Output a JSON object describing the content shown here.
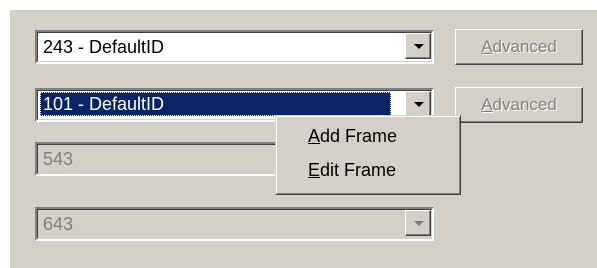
{
  "rows": [
    {
      "value": "243 - DefaultID",
      "state": "normal",
      "advanced_label": "Advanced",
      "advanced_accel": "A",
      "advanced_rest": "dvanced"
    },
    {
      "value": "101 - DefaultID",
      "state": "focused-selected",
      "advanced_label": "Advanced",
      "advanced_accel": "A",
      "advanced_rest": "dvanced"
    },
    {
      "value": "543",
      "state": "disabled"
    },
    {
      "value": "643",
      "state": "disabled"
    }
  ],
  "context_menu": {
    "items": [
      {
        "label": "Add Frame",
        "accel": "A",
        "rest": "dd Frame"
      },
      {
        "label": "Edit Frame",
        "accel": "E",
        "rest": "dit Frame"
      }
    ]
  },
  "colors": {
    "face": "#d4d0c8",
    "selection": "#0a246a",
    "disabled_text": "#808080"
  },
  "icons": [
    "dropdown-arrow-icon"
  ]
}
